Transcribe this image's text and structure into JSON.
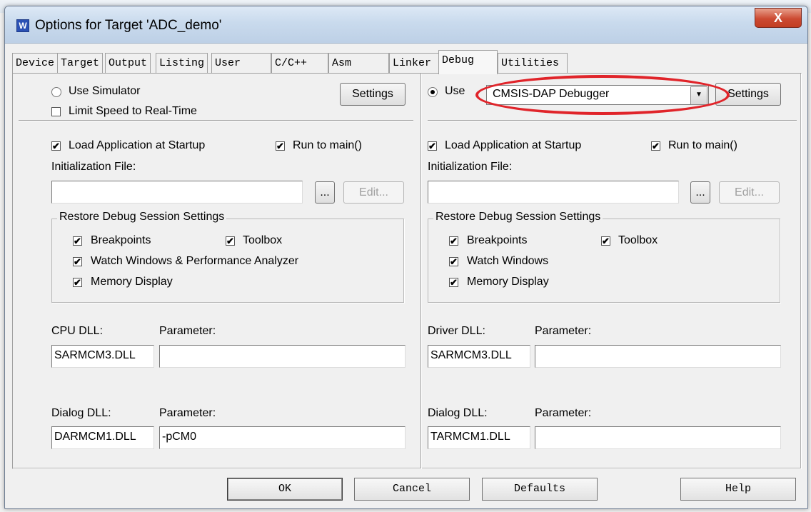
{
  "window": {
    "title": "Options for Target 'ADC_demo'",
    "close_glyph": "X"
  },
  "tabs": [
    {
      "label": "Device"
    },
    {
      "label": "Target"
    },
    {
      "label": "Output"
    },
    {
      "label": "Listing"
    },
    {
      "label": "User"
    },
    {
      "label": "C/C++"
    },
    {
      "label": "Asm"
    },
    {
      "label": "Linker"
    },
    {
      "label": "Debug",
      "active": true
    },
    {
      "label": "Utilities"
    }
  ],
  "left": {
    "use_simulator": "Use Simulator",
    "limit_speed": "Limit Speed to Real-Time",
    "settings": "Settings",
    "load_app": "Load Application at Startup",
    "run_to_main": "Run to main()",
    "init_file_label": "Initialization File:",
    "init_file_value": "",
    "browse": "...",
    "edit": "Edit...",
    "restore_group": "Restore Debug Session Settings",
    "breakpoints": "Breakpoints",
    "toolbox": "Toolbox",
    "watch": "Watch Windows & Performance Analyzer",
    "memory": "Memory Display",
    "cpu_dll_label": "CPU DLL:",
    "cpu_dll_value": "SARMCM3.DLL",
    "param_label": "Parameter:",
    "cpu_param_value": "",
    "dialog_dll_label": "Dialog DLL:",
    "dialog_dll_value": "DARMCM1.DLL",
    "dialog_param_value": "-pCM0"
  },
  "right": {
    "use": "Use",
    "debugger": "CMSIS-DAP Debugger",
    "settings": "Settings",
    "load_app": "Load Application at Startup",
    "run_to_main": "Run to main()",
    "init_file_label": "Initialization File:",
    "init_file_value": "",
    "browse": "...",
    "edit": "Edit...",
    "restore_group": "Restore Debug Session Settings",
    "breakpoints": "Breakpoints",
    "toolbox": "Toolbox",
    "watch": "Watch Windows",
    "memory": "Memory Display",
    "driver_dll_label": "Driver DLL:",
    "driver_dll_value": "SARMCM3.DLL",
    "param_label": "Parameter:",
    "driver_param_value": "",
    "dialog_dll_label": "Dialog DLL:",
    "dialog_dll_value": "TARMCM1.DLL",
    "dialog_param_value": ""
  },
  "buttons": {
    "ok": "OK",
    "cancel": "Cancel",
    "defaults": "Defaults",
    "help": "Help"
  },
  "check_glyph": "✔",
  "colors": {
    "highlight": "#e0242a",
    "close": "#c94a33"
  }
}
